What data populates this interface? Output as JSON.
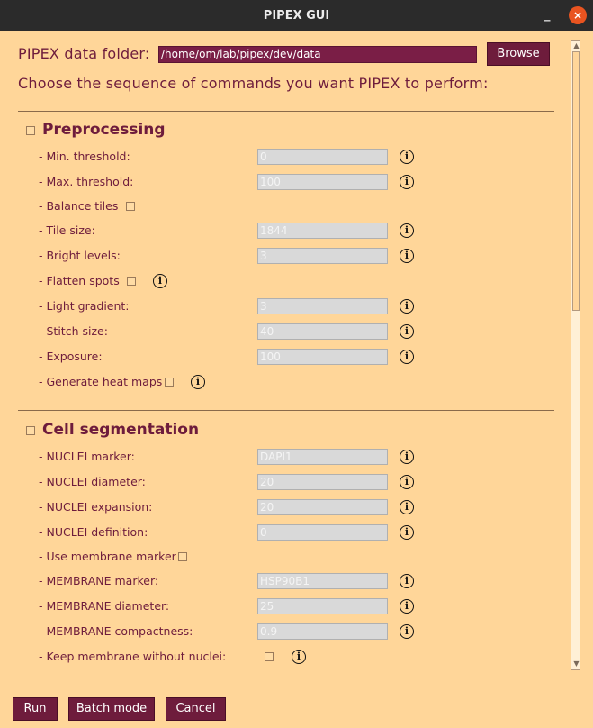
{
  "window": {
    "title": "PIPEX GUI",
    "minimize": "_",
    "close": "×"
  },
  "folder": {
    "label": "PIPEX data folder:",
    "value": "/home/om/lab/pipex/dev/data",
    "browse": "Browse"
  },
  "instructions": "Choose the sequence of commands you want PIPEX to perform:",
  "info_glyph": "i",
  "preprocessing": {
    "title": "Preprocessing",
    "rows": [
      {
        "label": "- Min. threshold:",
        "value": "0"
      },
      {
        "label": "- Max. threshold:",
        "value": "100"
      },
      {
        "label": "- Balance tiles"
      },
      {
        "label": "- Tile size:",
        "value": "1844"
      },
      {
        "label": "- Bright levels:",
        "value": "3"
      },
      {
        "label": "- Flatten spots"
      },
      {
        "label": "- Light gradient:",
        "value": "3"
      },
      {
        "label": "- Stitch size:",
        "value": "40"
      },
      {
        "label": "- Exposure:",
        "value": "100"
      },
      {
        "label": "- Generate heat maps"
      }
    ]
  },
  "segmentation": {
    "title": "Cell segmentation",
    "rows": [
      {
        "label": "- NUCLEI marker:",
        "value": "DAPI1"
      },
      {
        "label": "- NUCLEI diameter:",
        "value": "20"
      },
      {
        "label": "- NUCLEI expansion:",
        "value": "20"
      },
      {
        "label": "- NUCLEI definition:",
        "value": "0"
      },
      {
        "label": "- Use membrane marker"
      },
      {
        "label": "- MEMBRANE marker:",
        "value": "HSP90B1"
      },
      {
        "label": "- MEMBRANE diameter:",
        "value": "25"
      },
      {
        "label": "- MEMBRANE compactness:",
        "value": "0.9"
      },
      {
        "label": "- Keep membrane without nuclei:"
      }
    ]
  },
  "scrollbar": {
    "up": "▲",
    "down": "▼"
  },
  "buttons": {
    "run": "Run",
    "batch": "Batch mode",
    "cancel": "Cancel"
  }
}
